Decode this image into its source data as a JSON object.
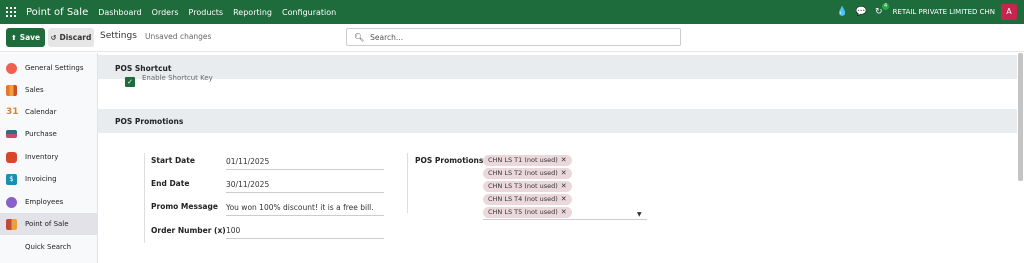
{
  "navbar": {
    "app_name": "Point of Sale",
    "menu": [
      "Dashboard",
      "Orders",
      "Products",
      "Reporting",
      "Configuration"
    ],
    "activity_count": "4",
    "company": "RETAIL PRIVATE LIMITED CHN",
    "avatar_letter": "A",
    "brand_color": "#1e6b3c"
  },
  "control": {
    "save_label": "Save",
    "discard_label": "Discard",
    "page_title": "Settings",
    "unsaved": "Unsaved changes",
    "search_placeholder": "Search..."
  },
  "sidebar": {
    "items": [
      {
        "label": "General Settings",
        "icon": "general-settings-icon",
        "color": "#f06050"
      },
      {
        "label": "Sales",
        "icon": "sales-icon",
        "color": "#e8752b"
      },
      {
        "label": "Calendar",
        "icon": "calendar-icon",
        "color": "#d9822b"
      },
      {
        "label": "Purchase",
        "icon": "purchase-icon",
        "color": "#2a6f7a"
      },
      {
        "label": "Inventory",
        "icon": "inventory-icon",
        "color": "#d6472b"
      },
      {
        "label": "Invoicing",
        "icon": "invoicing-icon",
        "color": "#1a8fb5"
      },
      {
        "label": "Employees",
        "icon": "employees-icon",
        "color": "#8a5fc7"
      },
      {
        "label": "Point of Sale",
        "icon": "point-of-sale-icon",
        "color": "#c24a3a"
      },
      {
        "label": "Quick Search",
        "icon": "",
        "color": ""
      }
    ],
    "active": "Point of Sale"
  },
  "sections": {
    "shortcut_title": "POS Shortcut",
    "shortcut_partial_text": "Enable Shortcut Key",
    "promotions_title": "POS Promotions"
  },
  "form": {
    "start_date_label": "Start Date",
    "start_date": "01/11/2025",
    "end_date_label": "End Date",
    "end_date": "30/11/2025",
    "promo_message_label": "Promo Message",
    "promo_message": "You won 100% discount! it is a free bill.",
    "order_number_label": "Order Number (x)",
    "order_number": "100",
    "pos_promotions_label": "POS Promotions",
    "promotions": [
      "CHN LS T1 (not used)",
      "CHN LS T2 (not used)",
      "CHN LS T3 (not used)",
      "CHN LS T4 (not used)",
      "CHN LS T5 (not used)"
    ]
  }
}
